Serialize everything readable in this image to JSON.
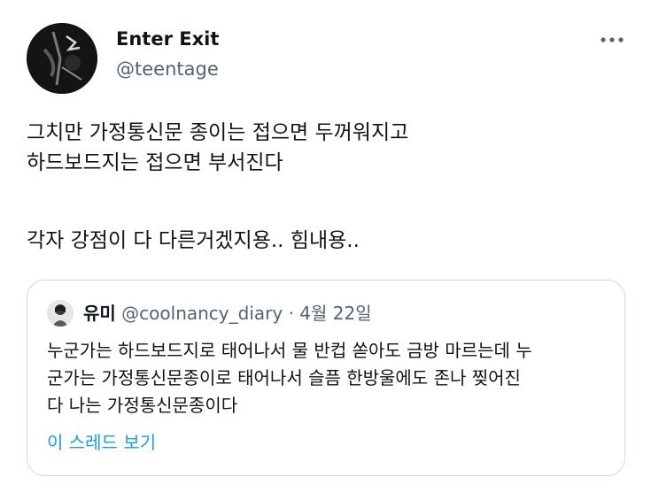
{
  "author": {
    "display_name": "Enter Exit",
    "handle": "@teentage",
    "avatar": "dark-photo-avatar"
  },
  "more_icon": "more-horizontal-icon",
  "tweet": {
    "lines": [
      "그치만 가정통신문 종이는 접으면 두꺼워지고",
      "하드보드지는 접으면 부서진다",
      "각자 강점이 다 다른거겠지용.. 힘내용.."
    ]
  },
  "quote": {
    "display_name": "유미",
    "handle": "@coolnancy_diary",
    "separator": "·",
    "date": "4월 22일",
    "lines": [
      "누군가는 하드보드지로 태어나서 물 반컵 쏟아도 금방 마르는데 누",
      "군가는 가정통신문종이로 태어나서 슬픔 한방울에도 존나 찢어진",
      "다 나는 가정통신문종이다"
    ],
    "show_thread": "이 스레드 보기"
  },
  "colors": {
    "text_primary": "#0f1419",
    "text_secondary": "#536471",
    "link": "#1d9bf0",
    "border": "#cfd9de"
  }
}
